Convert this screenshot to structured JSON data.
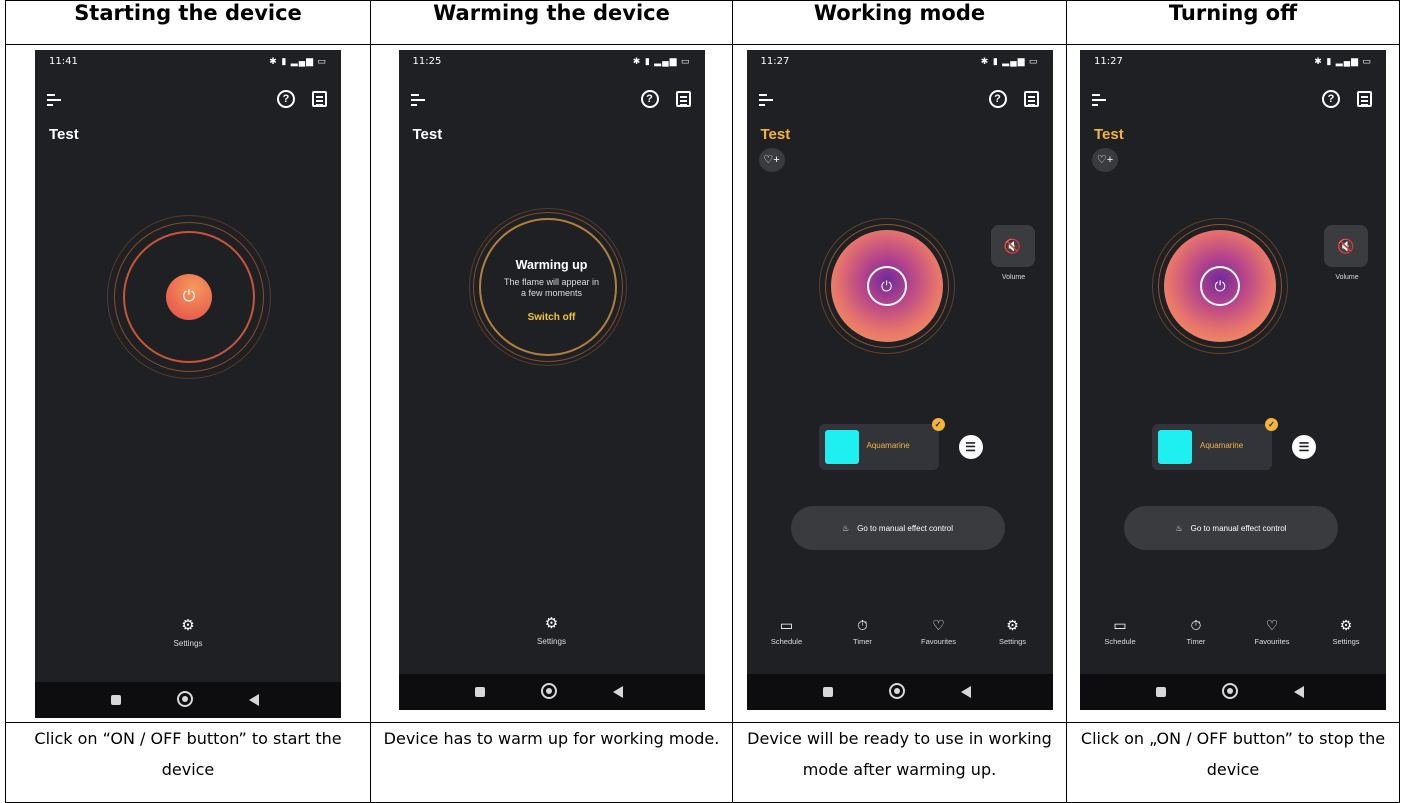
{
  "columns": [
    {
      "header": "Starting the device",
      "caption": "Click on “ON / OFF button” to start the device",
      "phone": {
        "time": "11:41",
        "device": "Test",
        "nav_single": "Settings"
      }
    },
    {
      "header": "Warming the device",
      "caption": "Device has to warm up for working mode.",
      "phone": {
        "time": "11:25",
        "device": "Test",
        "nav_single": "Settings",
        "warm_title": "Warming up",
        "warm_line1": "The flame will appear in",
        "warm_line2": "a few moments",
        "switch_off": "Switch off"
      }
    },
    {
      "header": "Working mode",
      "caption": "Device will be ready to use in working mode after warming up.",
      "phone": {
        "time": "11:27",
        "device": "Test",
        "volume": "Volume",
        "color_name": "Aquamarine",
        "manual": "Go to manual effect control",
        "nav": [
          "Schedule",
          "Timer",
          "Favourites",
          "Settings"
        ]
      }
    },
    {
      "header": "Turning off",
      "caption": "Click on „ON / OFF button” to stop the device",
      "phone": {
        "time": "11:27",
        "device": "Test",
        "volume": "Volume",
        "color_name": "Aquamarine",
        "manual": "Go to manual effect control",
        "nav": [
          "Schedule",
          "Timer",
          "Favourites",
          "Settings"
        ]
      }
    }
  ],
  "colors": {
    "accent_gold": "#f3b43c",
    "phone_bg": "#1f2023",
    "swatch": "#1ef0f2"
  }
}
